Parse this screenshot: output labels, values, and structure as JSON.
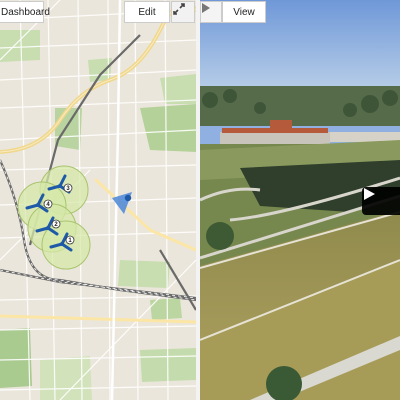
{
  "map_toolbar": {
    "dashboard_label": "Dashboard",
    "edit_label": "Edit",
    "fullscreen_icon": "expand-icon"
  },
  "view_toolbar": {
    "play_icon": "play-icon",
    "view_label": "View"
  },
  "map": {
    "turbine_count": 4,
    "turbine_badges": [
      "3",
      "4",
      "2",
      "1"
    ],
    "marker_icon": "location-pin-icon"
  },
  "video_overlay": {
    "play_icon": "play-icon"
  },
  "colors": {
    "map_base": "#e9e4d8",
    "park_green": "#b9d4a0",
    "turbine_zone": "#d6e8a8",
    "turbine_blue": "#1e5aa8",
    "railway": "#666666",
    "sky": "#8fb0e0",
    "field": "#a59a4c"
  }
}
